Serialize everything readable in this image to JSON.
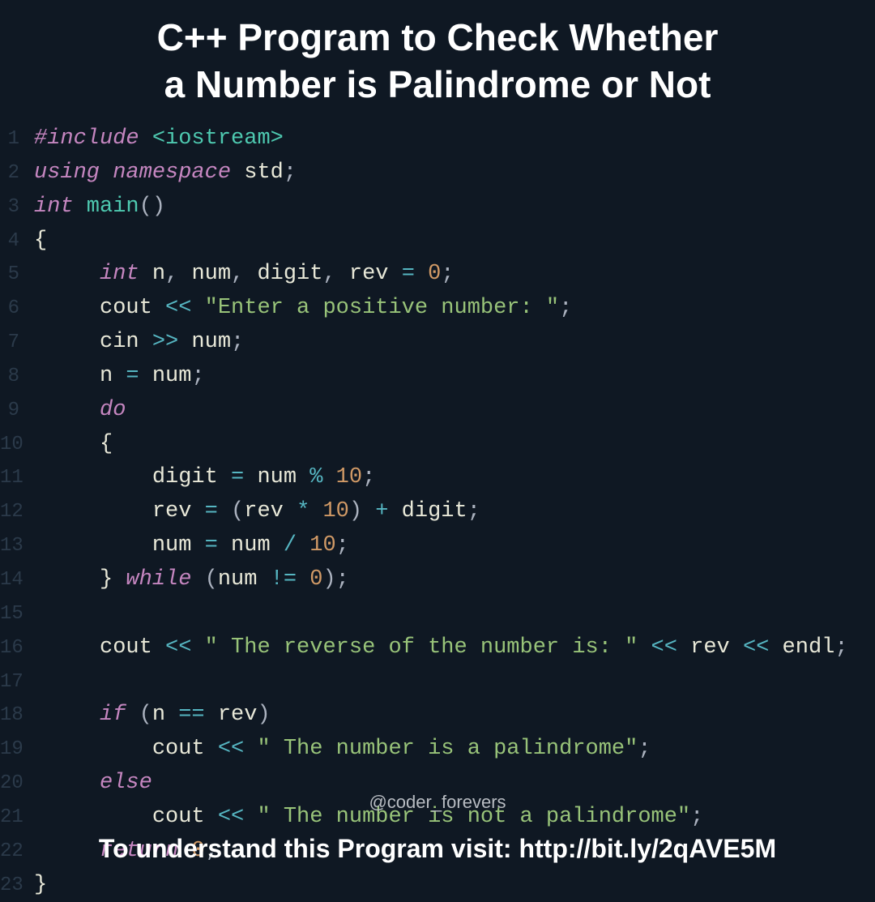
{
  "title_line1": "C++ Program to Check Whether",
  "title_line2": "a Number is Palindrome or Not",
  "watermark": "@coder_forevers",
  "footer": "To understand this Program visit: http://bit.ly/2qAVE5M",
  "code": {
    "lines": [
      {
        "n": "1",
        "tokens": [
          {
            "c": "kw-preproc",
            "t": "#include "
          },
          {
            "c": "kw-include-path",
            "t": "<iostream>"
          }
        ]
      },
      {
        "n": "2",
        "tokens": [
          {
            "c": "kw-keyword",
            "t": "using namespace"
          },
          {
            "c": "kw-var",
            "t": " std"
          },
          {
            "c": "kw-punct",
            "t": ";"
          }
        ]
      },
      {
        "n": "3",
        "tokens": [
          {
            "c": "kw-type",
            "t": "int"
          },
          {
            "c": "kw-func",
            "t": " main"
          },
          {
            "c": "kw-punct",
            "t": "()"
          }
        ]
      },
      {
        "n": "4",
        "tokens": [
          {
            "c": "kw-brace",
            "t": "{"
          }
        ]
      },
      {
        "n": "5",
        "tokens": [
          {
            "c": "",
            "t": "     "
          },
          {
            "c": "kw-type",
            "t": "int"
          },
          {
            "c": "kw-var",
            "t": " n"
          },
          {
            "c": "kw-punct",
            "t": ", "
          },
          {
            "c": "kw-var",
            "t": "num"
          },
          {
            "c": "kw-punct",
            "t": ", "
          },
          {
            "c": "kw-var",
            "t": "digit"
          },
          {
            "c": "kw-punct",
            "t": ", "
          },
          {
            "c": "kw-var",
            "t": "rev "
          },
          {
            "c": "kw-op",
            "t": "="
          },
          {
            "c": "kw-num",
            "t": " 0"
          },
          {
            "c": "kw-punct",
            "t": ";"
          }
        ]
      },
      {
        "n": "6",
        "tokens": [
          {
            "c": "",
            "t": "     "
          },
          {
            "c": "kw-var",
            "t": "cout "
          },
          {
            "c": "kw-op",
            "t": "<<"
          },
          {
            "c": "kw-string",
            "t": " \"Enter a positive number: \""
          },
          {
            "c": "kw-punct",
            "t": ";"
          }
        ]
      },
      {
        "n": "7",
        "tokens": [
          {
            "c": "",
            "t": "     "
          },
          {
            "c": "kw-var",
            "t": "cin "
          },
          {
            "c": "kw-op",
            "t": ">>"
          },
          {
            "c": "kw-var",
            "t": " num"
          },
          {
            "c": "kw-punct",
            "t": ";"
          }
        ]
      },
      {
        "n": "8",
        "tokens": [
          {
            "c": "",
            "t": "     "
          },
          {
            "c": "kw-var",
            "t": "n "
          },
          {
            "c": "kw-op",
            "t": "="
          },
          {
            "c": "kw-var",
            "t": " num"
          },
          {
            "c": "kw-punct",
            "t": ";"
          }
        ]
      },
      {
        "n": "9",
        "tokens": [
          {
            "c": "",
            "t": "     "
          },
          {
            "c": "kw-keyword",
            "t": "do"
          }
        ]
      },
      {
        "n": "10",
        "tokens": [
          {
            "c": "",
            "t": "     "
          },
          {
            "c": "kw-brace",
            "t": "{"
          }
        ]
      },
      {
        "n": "11",
        "tokens": [
          {
            "c": "",
            "t": "         "
          },
          {
            "c": "kw-var",
            "t": "digit "
          },
          {
            "c": "kw-op",
            "t": "="
          },
          {
            "c": "kw-var",
            "t": " num "
          },
          {
            "c": "kw-op",
            "t": "%"
          },
          {
            "c": "kw-num",
            "t": " 10"
          },
          {
            "c": "kw-punct",
            "t": ";"
          }
        ]
      },
      {
        "n": "12",
        "tokens": [
          {
            "c": "",
            "t": "         "
          },
          {
            "c": "kw-var",
            "t": "rev "
          },
          {
            "c": "kw-op",
            "t": "="
          },
          {
            "c": "kw-punct",
            "t": " ("
          },
          {
            "c": "kw-var",
            "t": "rev "
          },
          {
            "c": "kw-op",
            "t": "*"
          },
          {
            "c": "kw-num",
            "t": " 10"
          },
          {
            "c": "kw-punct",
            "t": ") "
          },
          {
            "c": "kw-op",
            "t": "+"
          },
          {
            "c": "kw-var",
            "t": " digit"
          },
          {
            "c": "kw-punct",
            "t": ";"
          }
        ]
      },
      {
        "n": "13",
        "tokens": [
          {
            "c": "",
            "t": "         "
          },
          {
            "c": "kw-var",
            "t": "num "
          },
          {
            "c": "kw-op",
            "t": "="
          },
          {
            "c": "kw-var",
            "t": " num "
          },
          {
            "c": "kw-op",
            "t": "/"
          },
          {
            "c": "kw-num",
            "t": " 10"
          },
          {
            "c": "kw-punct",
            "t": ";"
          }
        ]
      },
      {
        "n": "14",
        "tokens": [
          {
            "c": "",
            "t": "     "
          },
          {
            "c": "kw-brace",
            "t": "}"
          },
          {
            "c": "kw-keyword",
            "t": " while "
          },
          {
            "c": "kw-punct",
            "t": "("
          },
          {
            "c": "kw-var",
            "t": "num "
          },
          {
            "c": "kw-op",
            "t": "!="
          },
          {
            "c": "kw-num",
            "t": " 0"
          },
          {
            "c": "kw-punct",
            "t": ");"
          }
        ]
      },
      {
        "n": "15",
        "tokens": []
      },
      {
        "n": "16",
        "tokens": [
          {
            "c": "",
            "t": "     "
          },
          {
            "c": "kw-var",
            "t": "cout "
          },
          {
            "c": "kw-op",
            "t": "<<"
          },
          {
            "c": "kw-string",
            "t": " \" The reverse of the number is: \""
          },
          {
            "c": "kw-op",
            "t": " <<"
          },
          {
            "c": "kw-var",
            "t": " rev "
          },
          {
            "c": "kw-op",
            "t": "<<"
          },
          {
            "c": "kw-var",
            "t": " endl"
          },
          {
            "c": "kw-punct",
            "t": ";"
          }
        ]
      },
      {
        "n": "17",
        "tokens": []
      },
      {
        "n": "18",
        "tokens": [
          {
            "c": "",
            "t": "     "
          },
          {
            "c": "kw-keyword",
            "t": "if "
          },
          {
            "c": "kw-punct",
            "t": "("
          },
          {
            "c": "kw-var",
            "t": "n "
          },
          {
            "c": "kw-op",
            "t": "=="
          },
          {
            "c": "kw-var",
            "t": " rev"
          },
          {
            "c": "kw-punct",
            "t": ")"
          }
        ]
      },
      {
        "n": "19",
        "tokens": [
          {
            "c": "",
            "t": "         "
          },
          {
            "c": "kw-var",
            "t": "cout "
          },
          {
            "c": "kw-op",
            "t": "<<"
          },
          {
            "c": "kw-string",
            "t": " \" The number is a palindrome\""
          },
          {
            "c": "kw-punct",
            "t": ";"
          }
        ]
      },
      {
        "n": "20",
        "tokens": [
          {
            "c": "",
            "t": "     "
          },
          {
            "c": "kw-keyword",
            "t": "else"
          }
        ]
      },
      {
        "n": "21",
        "tokens": [
          {
            "c": "",
            "t": "         "
          },
          {
            "c": "kw-var",
            "t": "cout "
          },
          {
            "c": "kw-op",
            "t": "<<"
          },
          {
            "c": "kw-string",
            "t": " \" The number is not a palindrome\""
          },
          {
            "c": "kw-punct",
            "t": ";"
          }
        ]
      },
      {
        "n": "22",
        "tokens": [
          {
            "c": "",
            "t": "     "
          },
          {
            "c": "kw-keyword",
            "t": "return "
          },
          {
            "c": "kw-num",
            "t": "0"
          },
          {
            "c": "kw-punct",
            "t": ";"
          }
        ]
      },
      {
        "n": "23",
        "tokens": [
          {
            "c": "kw-brace",
            "t": "}"
          }
        ]
      }
    ]
  }
}
